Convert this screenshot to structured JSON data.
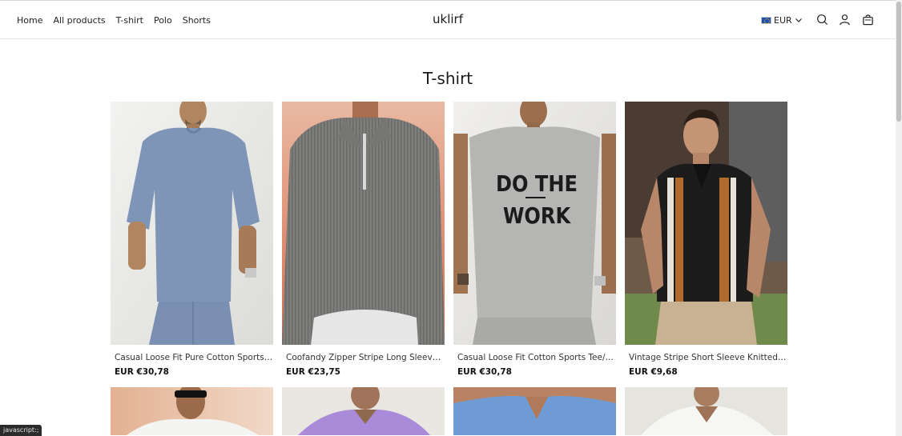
{
  "header": {
    "nav": [
      "Home",
      "All products",
      "T-shirt",
      "Polo",
      "Shorts"
    ],
    "brand": "uklirf",
    "currency": "EUR",
    "icons": [
      "search-icon",
      "account-icon",
      "cart-icon"
    ]
  },
  "page": {
    "title": "T-shirt"
  },
  "products": [
    {
      "name": "Casual Loose Fit Pure Cotton Sports T-shirt",
      "price": "EUR €30,78"
    },
    {
      "name": "Coofandy Zipper Stripe Long Sleeve Polo",
      "price": "EUR €23,75"
    },
    {
      "name": "Casual Loose Fit Cotton Sports Tee/ Sports",
      "price": "EUR €30,78"
    },
    {
      "name": "Vintage Stripe Short Sleeve Knitted Polo Shirt",
      "price": "EUR €9,68"
    }
  ],
  "product_images": {
    "text_print": [
      "DO THE",
      "WORK"
    ]
  },
  "status_bar": {
    "text": "javascript:;"
  },
  "colors": {
    "accent_flag": "#1f4fa8",
    "text": "#1a1a1a"
  }
}
